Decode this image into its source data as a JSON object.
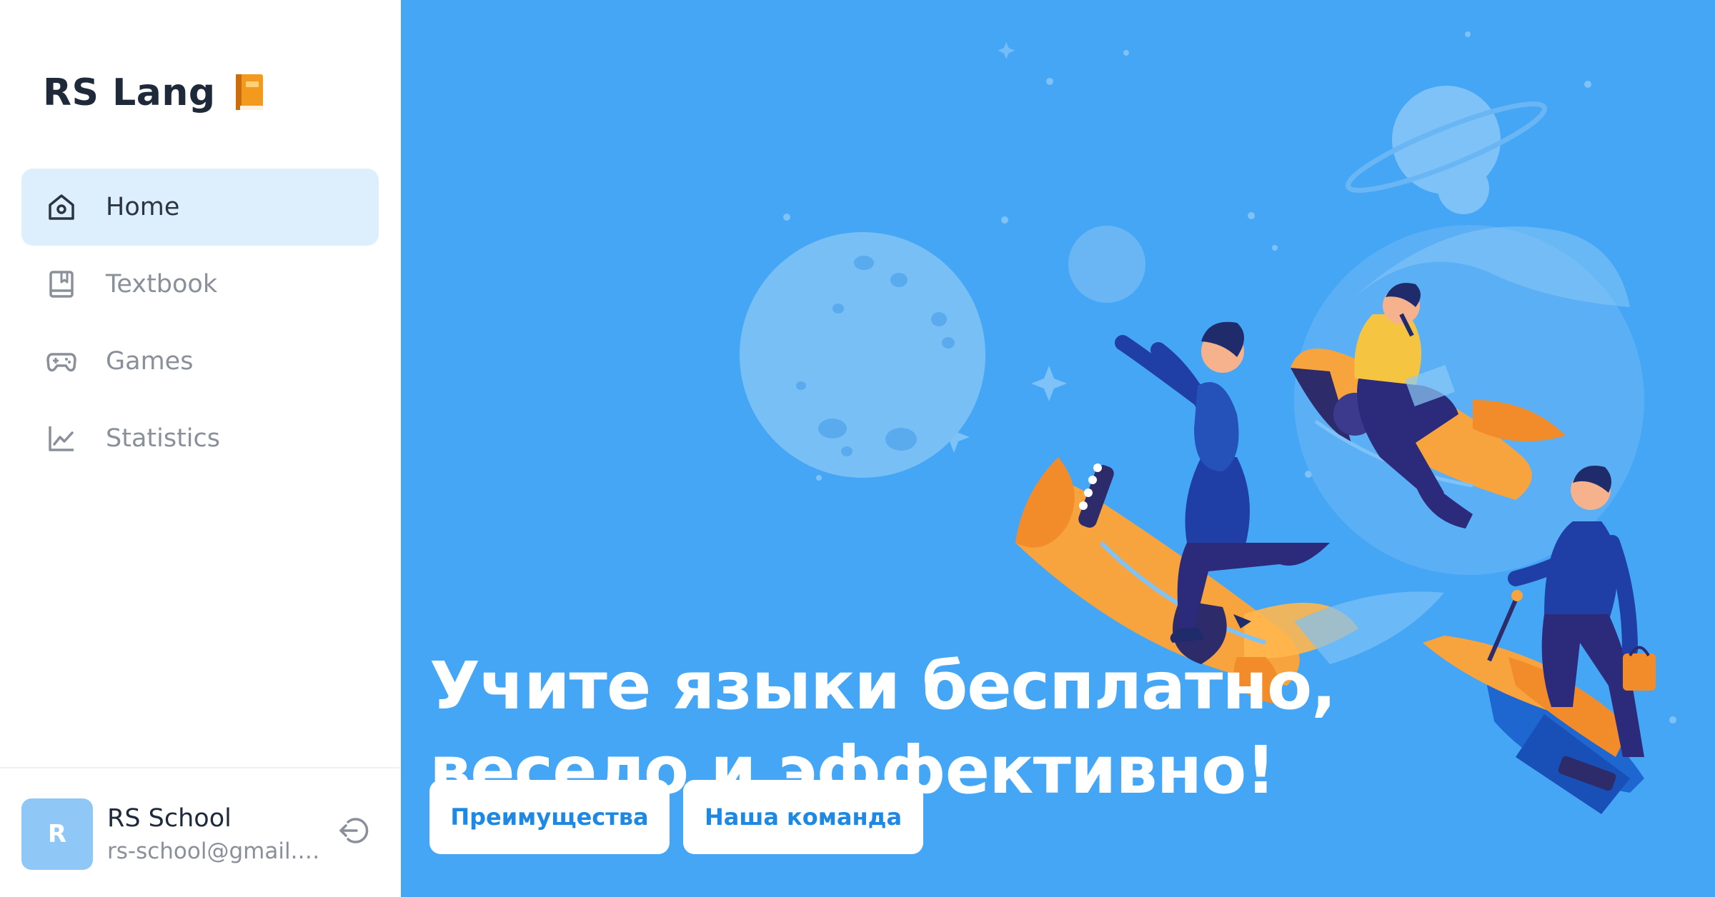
{
  "app": {
    "title": "RS Lang"
  },
  "sidebar": {
    "items": [
      {
        "label": "Home",
        "icon": "home-icon",
        "active": true
      },
      {
        "label": "Textbook",
        "icon": "book-icon",
        "active": false
      },
      {
        "label": "Games",
        "icon": "gamepad-icon",
        "active": false
      },
      {
        "label": "Statistics",
        "icon": "chart-line-icon",
        "active": false
      }
    ]
  },
  "user": {
    "initial": "R",
    "name": "RS School",
    "email": "rs-school@gmail.c..."
  },
  "hero": {
    "headline_line1": "Учите языки бесплатно,",
    "headline_line2": "весело и эффективно!",
    "button_advantages": "Преимущества",
    "button_team": "Наша команда"
  },
  "colors": {
    "hero_background": "#45a6f5",
    "active_nav_background": "#ddeefd",
    "accent": "#1e88e5",
    "avatar": "#8fc7f7",
    "rocket_orange": "#f7a43f"
  }
}
